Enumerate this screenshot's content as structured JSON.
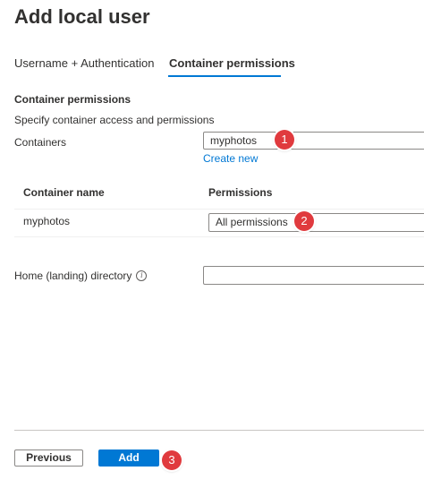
{
  "header": {
    "title": "Add local user"
  },
  "tabs": [
    {
      "label": "Username + Authentication",
      "active": false
    },
    {
      "label": "Container permissions",
      "active": true
    }
  ],
  "section": {
    "heading": "Container permissions",
    "description": "Specify container access and permissions"
  },
  "containers": {
    "label": "Containers",
    "selected": "myphotos",
    "create_new": "Create new"
  },
  "table": {
    "headers": [
      "Container name",
      "Permissions"
    ],
    "rows": [
      {
        "name": "myphotos",
        "permissions": "All permissions"
      }
    ]
  },
  "home_directory": {
    "label": "Home (landing) directory",
    "value": ""
  },
  "footer": {
    "previous": "Previous",
    "add": "Add"
  },
  "callouts": [
    "1",
    "2",
    "3"
  ],
  "colors": {
    "accent": "#0078d4",
    "callout": "#e03a3e"
  }
}
